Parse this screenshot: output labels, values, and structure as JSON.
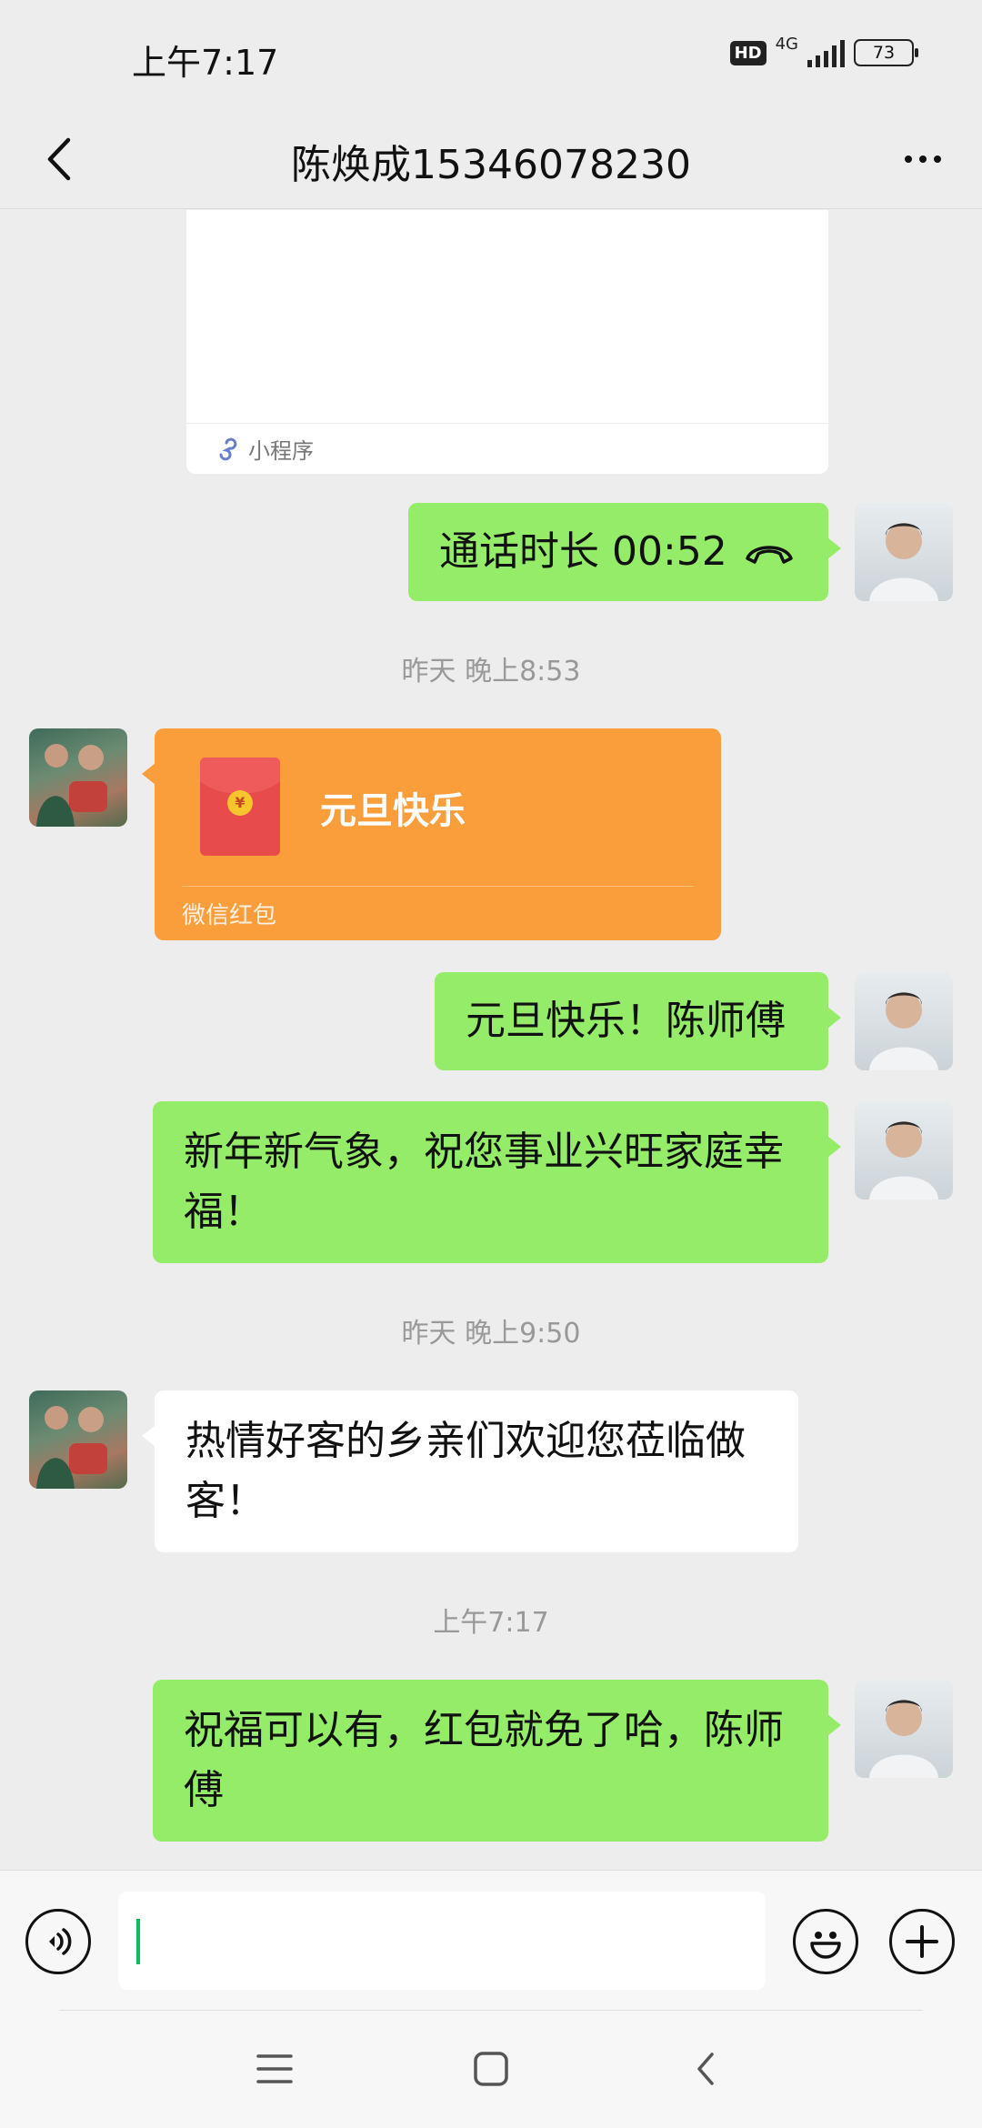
{
  "status_bar": {
    "time": "上午7:17",
    "hd": "HD",
    "network": "4G",
    "battery": "73"
  },
  "nav": {
    "title": "陈焕成15346078230"
  },
  "mini_program": {
    "label": "小程序"
  },
  "messages": {
    "call": "通话时长 00:52",
    "ts1": "昨天 晚上8:53",
    "redpacket_title": "元旦快乐",
    "redpacket_label": "微信红包",
    "msg_greet": "元旦快乐！陈师傅",
    "msg_newyear": "新年新气象，祝您事业兴旺家庭幸福！",
    "ts2": "昨天 晚上9:50",
    "msg_welcome": "热情好客的乡亲们欢迎您莅临做客！",
    "ts3": "上午7:17",
    "msg_reply": "祝福可以有，红包就免了哈，陈师傅"
  },
  "colors": {
    "self_bubble": "#95ec69",
    "other_bubble": "#ffffff",
    "redpacket": "#fa9d3b",
    "caret": "#07c160"
  },
  "icons": [
    "back-arrow-icon",
    "more-dots-icon",
    "mini-program-icon",
    "phone-hangup-icon",
    "red-packet-icon",
    "voice-icon",
    "emoji-icon",
    "plus-icon",
    "menu-icon",
    "home-square-icon",
    "back-nav-icon"
  ]
}
